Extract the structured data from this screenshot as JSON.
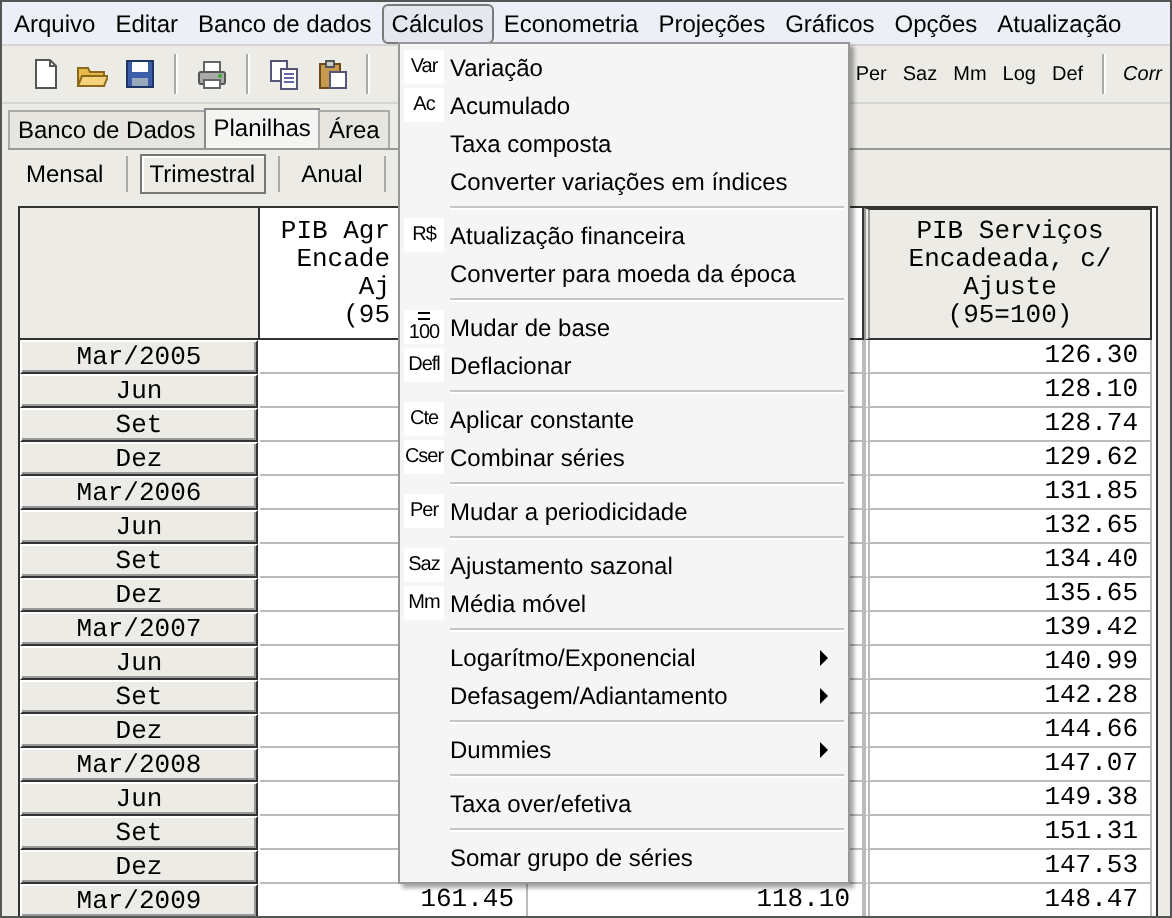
{
  "menubar": [
    {
      "label": "Arquivo",
      "selected": false
    },
    {
      "label": "Editar",
      "selected": false
    },
    {
      "label": "Banco de dados",
      "selected": false
    },
    {
      "label": "Cálculos",
      "selected": true
    },
    {
      "label": "Econometria",
      "selected": false
    },
    {
      "label": "Projeções",
      "selected": false
    },
    {
      "label": "Gráficos",
      "selected": false
    },
    {
      "label": "Opções",
      "selected": false
    },
    {
      "label": "Atualização",
      "selected": false
    }
  ],
  "toolbar": {
    "text_buttons": [
      [
        "Per",
        "Saz",
        "Mm",
        "Log",
        "Def"
      ],
      [
        "Corr"
      ]
    ]
  },
  "tabs": [
    {
      "label": "Banco de Dados",
      "selected": false
    },
    {
      "label": "Planilhas",
      "selected": true
    },
    {
      "label": "Área",
      "selected": false
    }
  ],
  "subtabs": [
    {
      "label": "Mensal",
      "selected": false
    },
    {
      "label": "Trimestral",
      "selected": true
    },
    {
      "label": "Anual",
      "selected": false
    }
  ],
  "sheet": {
    "columns": [
      {
        "kind": "partial",
        "header": [
          "PIB Agr",
          "Encade",
          "Aj",
          "(95"
        ]
      },
      {
        "kind": "covered"
      },
      {
        "kind": "full",
        "header": [
          "PIB Serviços",
          "Encadeada, c/",
          "Ajuste",
          "(95=100)"
        ]
      }
    ],
    "rows": [
      {
        "period": "Mar/2005",
        "cells": [
          null,
          null,
          "126.30"
        ]
      },
      {
        "period": "Jun",
        "cells": [
          null,
          null,
          "128.10"
        ]
      },
      {
        "period": "Set",
        "cells": [
          null,
          null,
          "128.74"
        ]
      },
      {
        "period": "Dez",
        "cells": [
          null,
          null,
          "129.62"
        ]
      },
      {
        "period": "Mar/2006",
        "cells": [
          null,
          null,
          "131.85"
        ]
      },
      {
        "period": "Jun",
        "cells": [
          null,
          null,
          "132.65"
        ]
      },
      {
        "period": "Set",
        "cells": [
          null,
          null,
          "134.40"
        ]
      },
      {
        "period": "Dez",
        "cells": [
          null,
          null,
          "135.65"
        ]
      },
      {
        "period": "Mar/2007",
        "cells": [
          null,
          null,
          "139.42"
        ]
      },
      {
        "period": "Jun",
        "cells": [
          null,
          null,
          "140.99"
        ]
      },
      {
        "period": "Set",
        "cells": [
          null,
          null,
          "142.28"
        ]
      },
      {
        "period": "Dez",
        "cells": [
          null,
          null,
          "144.66"
        ]
      },
      {
        "period": "Mar/2008",
        "cells": [
          null,
          null,
          "147.07"
        ]
      },
      {
        "period": "Jun",
        "cells": [
          null,
          null,
          "149.38"
        ]
      },
      {
        "period": "Set",
        "cells": [
          null,
          null,
          "151.31"
        ]
      },
      {
        "period": "Dez",
        "cells": [
          null,
          null,
          "147.53"
        ]
      },
      {
        "period": "Mar/2009",
        "cells": [
          "161.45",
          "118.10",
          "148.47"
        ]
      }
    ]
  },
  "menu": {
    "groups": [
      [
        {
          "label": "Variação",
          "badge": "Var",
          "submenu": false
        },
        {
          "label": "Acumulado",
          "badge": "Ac",
          "submenu": false
        },
        {
          "label": "Taxa composta",
          "submenu": false
        },
        {
          "label": "Converter variações em índices",
          "submenu": false
        }
      ],
      [
        {
          "label": "Atualização financeira",
          "badge": "R$",
          "submenu": false
        },
        {
          "label": "Converter para moeda da época",
          "submenu": false
        }
      ],
      [
        {
          "label": "Mudar de base",
          "badge": "100",
          "kind": "base",
          "submenu": false
        },
        {
          "label": "Deflacionar",
          "badge": "Defl",
          "submenu": false
        }
      ],
      [
        {
          "label": "Aplicar constante",
          "badge": "Cte",
          "submenu": false
        },
        {
          "label": "Combinar séries",
          "badge": "Cser",
          "submenu": false
        }
      ],
      [
        {
          "label": "Mudar a periodicidade",
          "badge": "Per",
          "submenu": false
        }
      ],
      [
        {
          "label": "Ajustamento sazonal",
          "badge": "Saz",
          "submenu": false
        },
        {
          "label": "Média móvel",
          "badge": "Mm",
          "submenu": false
        }
      ],
      [
        {
          "label": "Logarítmo/Exponencial",
          "submenu": true
        },
        {
          "label": "Defasagem/Adiantamento",
          "submenu": true
        }
      ],
      [
        {
          "label": "Dummies",
          "submenu": true
        }
      ],
      [
        {
          "label": "Taxa over/efetiva",
          "submenu": false
        }
      ],
      [
        {
          "label": "Somar grupo de séries",
          "submenu": false
        }
      ]
    ]
  }
}
